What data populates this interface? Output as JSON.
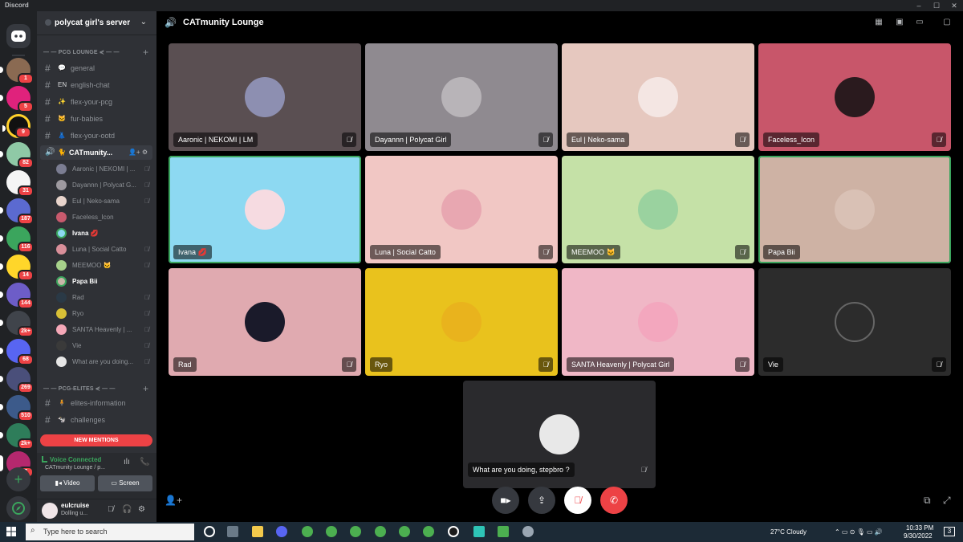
{
  "window": {
    "app_name": "Discord",
    "controls": [
      "–",
      "☐",
      "✕"
    ]
  },
  "rail": {
    "badges": [
      "1",
      "5",
      "9",
      "82",
      "31",
      "187",
      "116",
      "14",
      "144",
      "2k+",
      "68",
      "269",
      "510",
      "2k+",
      "7"
    ]
  },
  "server": {
    "name": "polycat girl's server"
  },
  "categories": {
    "lounge": "PCG LOUNGE",
    "elites": "PCG-ELITES"
  },
  "lounge_channels": [
    {
      "emoji": "💬",
      "label": "general"
    },
    {
      "emoji": "EN",
      "label": "english-chat"
    },
    {
      "emoji": "✨",
      "label": "flex-your-pcg"
    },
    {
      "emoji": "🐱",
      "label": "fur-babies"
    },
    {
      "emoji": "👗",
      "label": "flex-your-ootd"
    }
  ],
  "voice_channel": {
    "label": "CATmunity..."
  },
  "voice_users": [
    {
      "name": "Aaronic | NEKOMI | ...",
      "color": "#7b7d92"
    },
    {
      "name": "Dayannn | Polycat G...",
      "color": "#9e9aa0"
    },
    {
      "name": "Eul | Neko-sama",
      "color": "#e8d4cc"
    },
    {
      "name": "Faceless_Icon",
      "color": "#c85a6d"
    },
    {
      "name": "Ivana 💋",
      "color": "#4fbc6b",
      "speaking": true
    },
    {
      "name": "Luna | Social Catto",
      "color": "#d98f9a"
    },
    {
      "name": "MEEMOO 🐱",
      "color": "#a7d18b"
    },
    {
      "name": "Papa Bii",
      "color": "#c9b5a8",
      "speaking": true
    },
    {
      "name": "Rad",
      "color": "#2a3946"
    },
    {
      "name": "Ryo",
      "color": "#d8c036"
    },
    {
      "name": "SANTA Heavenly | ...",
      "color": "#f5a8b8"
    },
    {
      "name": "Vie",
      "color": "#3a3a3a"
    },
    {
      "name": "What are you doing...",
      "color": "#e6e6e6"
    }
  ],
  "elite_channels": [
    {
      "emoji": "🧍",
      "label": "elites-information"
    },
    {
      "emoji": "🐄",
      "label": "challenges"
    }
  ],
  "new_mentions": "NEW MENTIONS",
  "voice_status": {
    "title": "Voice Connected",
    "location": "CATmunity Lounge / p...",
    "video_label": "Video",
    "screen_label": "Screen"
  },
  "user": {
    "name": "eulcruise",
    "status": "Dolling u..."
  },
  "stage": {
    "title": "CATmunity Lounge"
  },
  "participants": [
    {
      "name": "Aaronic | NEKOMI | LM",
      "bg": "#5a4f52",
      "avatar": "#8d8fb1"
    },
    {
      "name": "Dayannn | Polycat Girl",
      "bg": "#8f8a90",
      "avatar": "#b8b4b8"
    },
    {
      "name": "Eul | Neko-sama",
      "bg": "#e6c8bf",
      "avatar": "#f4e6e3"
    },
    {
      "name": "Faceless_Icon",
      "bg": "#c8566a",
      "avatar": "#2a1a1e"
    },
    {
      "name": "Ivana 💋",
      "bg": "#8dd9f2",
      "avatar": "#f6dbe1",
      "speaking": true
    },
    {
      "name": "Luna | Social Catto",
      "bg": "#f1c7c4",
      "avatar": "#e8a7b1"
    },
    {
      "name": "MEEMOO 🐱",
      "bg": "#c5e1a7",
      "avatar": "#9ad29f"
    },
    {
      "name": "Papa Bii",
      "bg": "#ceb2a4",
      "avatar": "#d9c1b5",
      "speaking": true
    },
    {
      "name": "Rad",
      "bg": "#e0aab0",
      "avatar": "#1a1a2a"
    },
    {
      "name": "Ryo",
      "bg": "#e9c21d",
      "avatar": "#e9b31d"
    },
    {
      "name": "SANTA Heavenly | Polycat Girl",
      "bg": "#f0b7c6",
      "avatar": "#f3a7be"
    },
    {
      "name": "Vie",
      "bg": "#2c2c2c",
      "avatar": "#2c2c2c"
    }
  ],
  "self_tile": {
    "name": "What are you doing, stepbro ?"
  },
  "taskbar": {
    "search_placeholder": "Type here to search",
    "weather": "27°C  Cloudy",
    "time": "10:33 PM",
    "date": "9/30/2022",
    "notif_count": "3"
  }
}
